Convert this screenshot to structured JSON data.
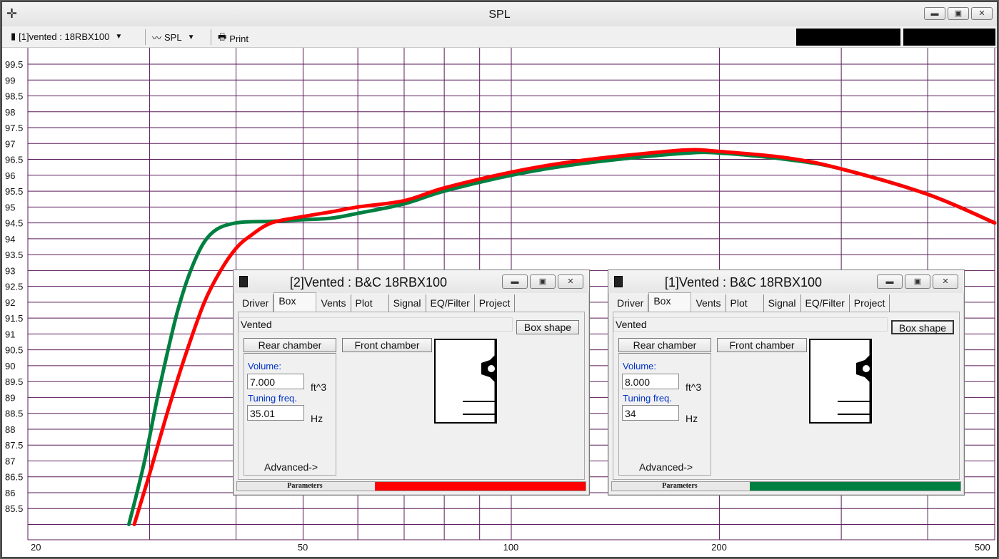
{
  "window": {
    "title": "SPL"
  },
  "toolbar": {
    "project_selector": "[1]vented : 18RBX100",
    "graph_selector": "SPL",
    "print_label": "Print"
  },
  "plot": {
    "y_ticks": [
      "99.5",
      "99",
      "98.5",
      "98",
      "97.5",
      "97",
      "96.5",
      "96",
      "95.5",
      "95",
      "94.5",
      "94",
      "93.5",
      "93",
      "92.5",
      "92",
      "91.5",
      "91",
      "90.5",
      "90",
      "89.5",
      "89",
      "88.5",
      "88",
      "87.5",
      "87",
      "86.5",
      "86",
      "85.5"
    ],
    "x_ticks": [
      "20",
      "50",
      "100",
      "200",
      "500"
    ],
    "series_colors": [
      "#ff0000",
      "#008040"
    ]
  },
  "chart_data": {
    "type": "line",
    "title": "SPL",
    "xscale": "log",
    "xlim": [
      20,
      500
    ],
    "ylim": [
      85,
      100
    ],
    "grid": true,
    "series": [
      {
        "color": "#ff0000",
        "x": [
          28.5,
          30,
          32,
          34,
          36,
          38,
          40,
          42,
          45,
          50,
          55,
          60,
          70,
          80,
          100,
          120,
          150,
          180,
          200,
          250,
          300,
          400,
          500
        ],
        "y": [
          85.0,
          86.6,
          88.7,
          90.5,
          92.0,
          93.0,
          93.7,
          94.1,
          94.5,
          94.7,
          94.85,
          95.0,
          95.2,
          95.6,
          96.1,
          96.4,
          96.65,
          96.8,
          96.75,
          96.55,
          96.2,
          95.4,
          94.5
        ]
      },
      {
        "color": "#008040",
        "x": [
          28,
          29.5,
          31,
          33,
          35,
          37,
          40,
          45,
          50,
          55,
          60,
          70,
          80,
          100,
          120,
          150,
          180,
          200,
          250,
          300,
          400,
          500
        ],
        "y": [
          85.0,
          87.0,
          89.3,
          91.8,
          93.4,
          94.2,
          94.5,
          94.55,
          94.6,
          94.65,
          94.8,
          95.1,
          95.5,
          96.0,
          96.3,
          96.55,
          96.7,
          96.7,
          96.5,
          96.2,
          95.4,
          94.5
        ]
      }
    ]
  },
  "sub_windows": [
    {
      "title": "[2]Vented : B&C 18RBX100",
      "tabs": [
        "Driver",
        "Box",
        "Vents",
        "Plot",
        "Signal",
        "EQ/Filter",
        "Project"
      ],
      "box_type": "Vented",
      "box_shape_label": "Box shape",
      "rear_chamber_label": "Rear chamber",
      "front_chamber_label": "Front chamber",
      "volume_label": "Volume:",
      "volume_value": "7.000",
      "volume_unit": "ft^3",
      "tuning_label": "Tuning freq.",
      "tuning_value": "35.01",
      "tuning_unit": "Hz",
      "advanced_label": "Advanced->",
      "status_label": "Parameters",
      "color": "#ff0000"
    },
    {
      "title": "[1]Vented : B&C 18RBX100",
      "tabs": [
        "Driver",
        "Box",
        "Vents",
        "Plot",
        "Signal",
        "EQ/Filter",
        "Project"
      ],
      "box_type": "Vented",
      "box_shape_label": "Box shape",
      "rear_chamber_label": "Rear chamber",
      "front_chamber_label": "Front chamber",
      "volume_label": "Volume:",
      "volume_value": "8.000",
      "volume_unit": "ft^3",
      "tuning_label": "Tuning freq.",
      "tuning_value": "34",
      "tuning_unit": "Hz",
      "advanced_label": "Advanced->",
      "status_label": "Parameters",
      "color": "#008040"
    }
  ]
}
